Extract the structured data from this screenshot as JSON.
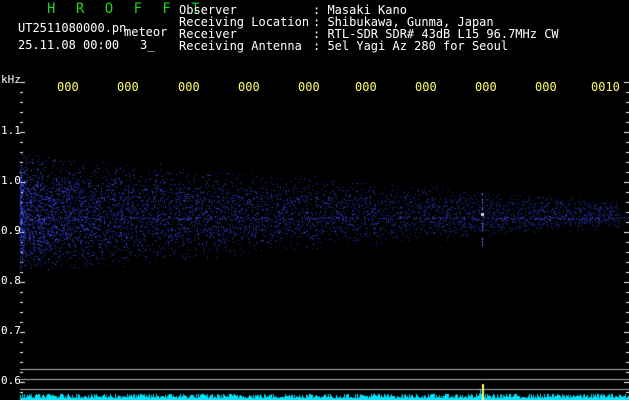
{
  "header": {
    "title": "H R O F F T",
    "filename": "UT2511080000.pn",
    "meteor_label": "meteor",
    "datetime": "25.11.08 00:00",
    "count": "3_"
  },
  "info": {
    "rows": [
      {
        "label": "Observer",
        "value": ": Masaki Kano"
      },
      {
        "label": "Receiving Location",
        "value": ": Shibukawa, Gunma, Japan"
      },
      {
        "label": "Receiver",
        "value": ": RTL-SDR SDR# 43dB L15 96.7MHz CW"
      },
      {
        "label": "Receiving Antenna",
        "value": ": 5el Yagi Az 280 for Seoul"
      }
    ]
  },
  "axis": {
    "unit": "kHz",
    "time_ticks": [
      "000",
      "000",
      "000",
      "000",
      "000",
      "000",
      "000",
      "000",
      "000",
      "0010"
    ],
    "freq_labels": [
      "1.1",
      "1.0",
      "0.9",
      "0.8",
      "0.7",
      "0.6"
    ]
  },
  "colors": {
    "background": "#000000",
    "signal": "#3a4cff",
    "grid": "#b0b0b0",
    "trace": "#00e5ff",
    "tick": "#ffff66",
    "title": "#1fd41f"
  }
}
